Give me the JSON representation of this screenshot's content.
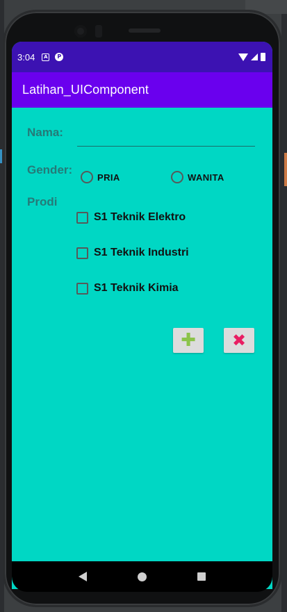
{
  "status_bar": {
    "time": "3:04",
    "icons": [
      "a-notification-icon",
      "p-notification-icon",
      "wifi-icon",
      "signal-icon",
      "battery-icon"
    ],
    "color": "#3c12b2"
  },
  "app_bar": {
    "title": "Latihan_UIComponent",
    "color": "#6a00ee"
  },
  "form": {
    "background": "#00d7c4",
    "nama_label": "Nama:",
    "nama_value": "",
    "gender_label": "Gender:",
    "gender_options": [
      {
        "label": "PRIA",
        "selected": false
      },
      {
        "label": "WANITA",
        "selected": false
      }
    ],
    "prodi_label": "Prodi",
    "prodi_options": [
      {
        "label": "S1 Teknik Elektro",
        "checked": false
      },
      {
        "label": "S1 Teknik Industri",
        "checked": false
      },
      {
        "label": "S1 Teknik Kimia",
        "checked": false
      }
    ],
    "add_button_icon": "plus-icon",
    "cancel_button_icon": "close-icon",
    "add_glyph": "✚",
    "cancel_glyph": "✖"
  },
  "nav_bar": {
    "buttons": [
      "back-icon",
      "home-icon",
      "recents-icon"
    ]
  }
}
